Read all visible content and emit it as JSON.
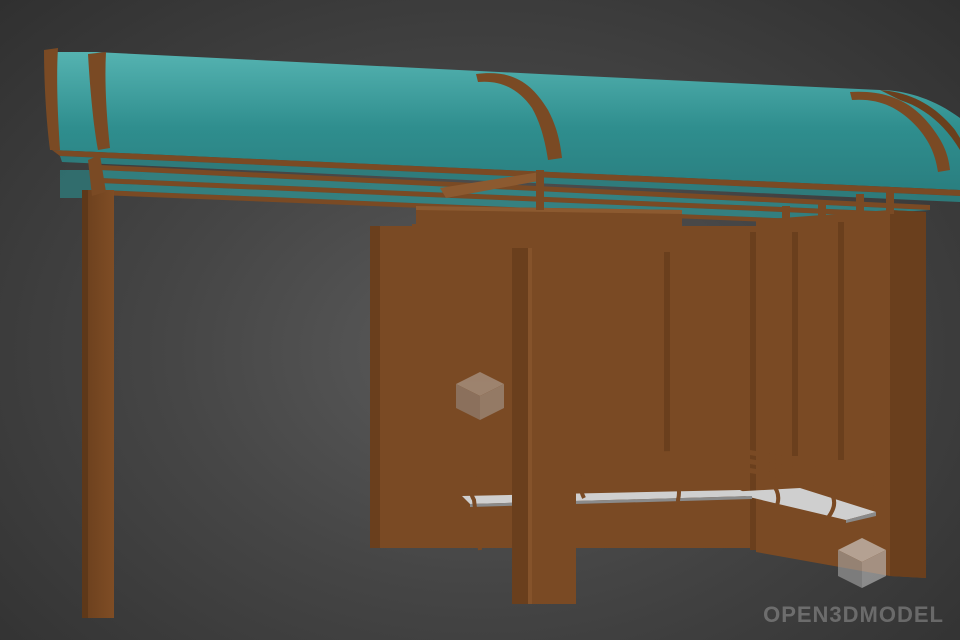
{
  "watermark": {
    "brand_text": "OPEN3DMODEL"
  },
  "colors": {
    "background_center": "#5b5b5b",
    "background_edge": "#303030",
    "wood": "#7a4a24",
    "wood_dark": "#5e3819",
    "wood_light": "#8c5a30",
    "roof_glass": "#2e8c8c",
    "roof_glass_light": "#4fb0ae",
    "bench_seat": "#cfcfcf"
  },
  "icons": {
    "watermark_logo": "cube-icon"
  }
}
